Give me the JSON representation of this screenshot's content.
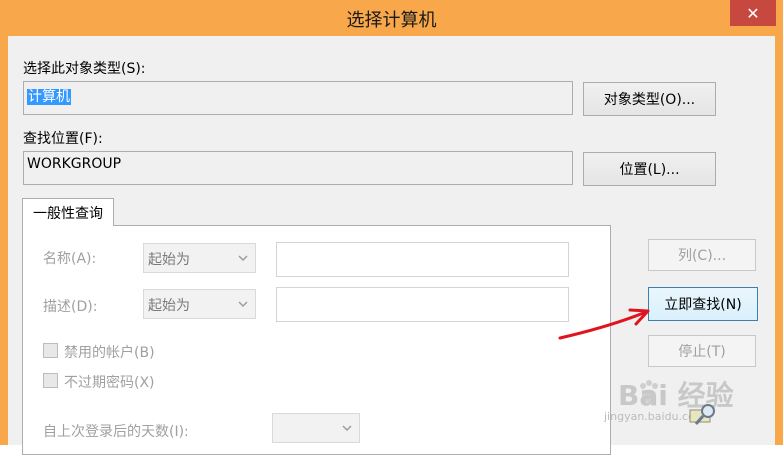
{
  "window": {
    "title": "选择计算机",
    "close_glyph": "✕"
  },
  "object_type": {
    "label": "选择此对象类型(S):",
    "value": "计算机",
    "button": "对象类型(O)..."
  },
  "location": {
    "label": "查找位置(F):",
    "value": "WORKGROUP",
    "button": "位置(L)..."
  },
  "tab": {
    "label": "一般性查询"
  },
  "query": {
    "name_label": "名称(A):",
    "name_combo": "起始为",
    "desc_label": "描述(D):",
    "desc_combo": "起始为",
    "disabled_accounts": "禁用的帐户(B)",
    "no_expire_password": "不过期密码(X)",
    "days_since_login_label": "自上次登录后的天数(I):"
  },
  "side_buttons": {
    "columns": "列(C)...",
    "find_now": "立即查找(N)",
    "stop": "停止(T)"
  },
  "annotation": {
    "arrow_color": "#e0141e"
  },
  "watermark": {
    "text": "Bai 经验",
    "url": "jingyan.baidu.com"
  }
}
